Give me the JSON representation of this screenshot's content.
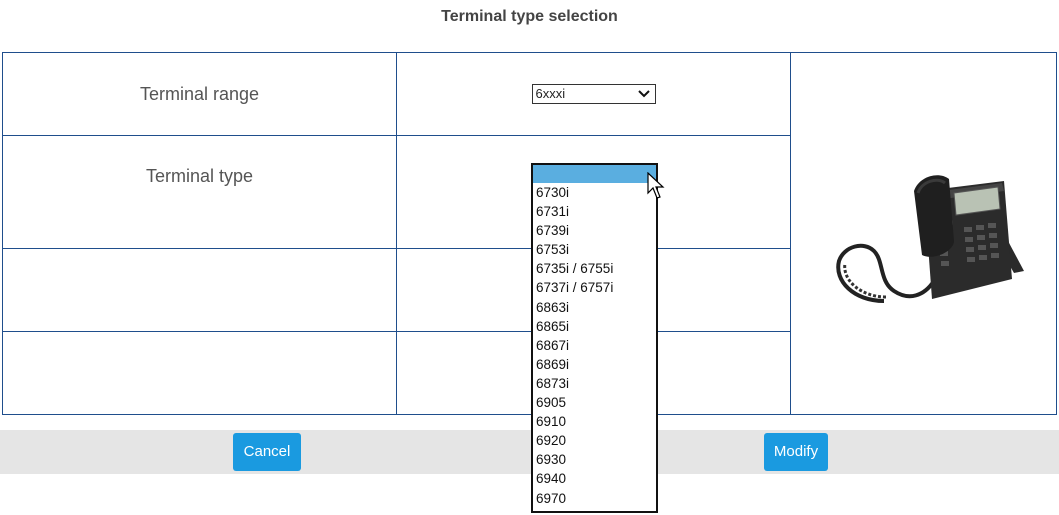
{
  "page": {
    "title": "Terminal type selection"
  },
  "form": {
    "terminal_range_label": "Terminal range",
    "terminal_range_value": "6xxxi",
    "terminal_type_label": "Terminal type"
  },
  "dropdown": {
    "options": [
      "6730i",
      "6731i",
      "6739i",
      "6753i",
      "6735i / 6755i",
      "6737i / 6757i",
      "6863i",
      "6865i",
      "6867i",
      "6869i",
      "6873i",
      "6905",
      "6910",
      "6920",
      "6930",
      "6940",
      "6970"
    ]
  },
  "actions": {
    "cancel_label": "Cancel",
    "modify_label": "Modify"
  },
  "icons": {
    "phone": "desk-phone-image",
    "cursor": "mouse-pointer-icon",
    "chevron": "chevron-down-icon"
  },
  "colors": {
    "border": "#1f4e8c",
    "button": "#1a9ae0",
    "highlight": "#5aaee0",
    "action_bar": "#e5e5e5"
  }
}
